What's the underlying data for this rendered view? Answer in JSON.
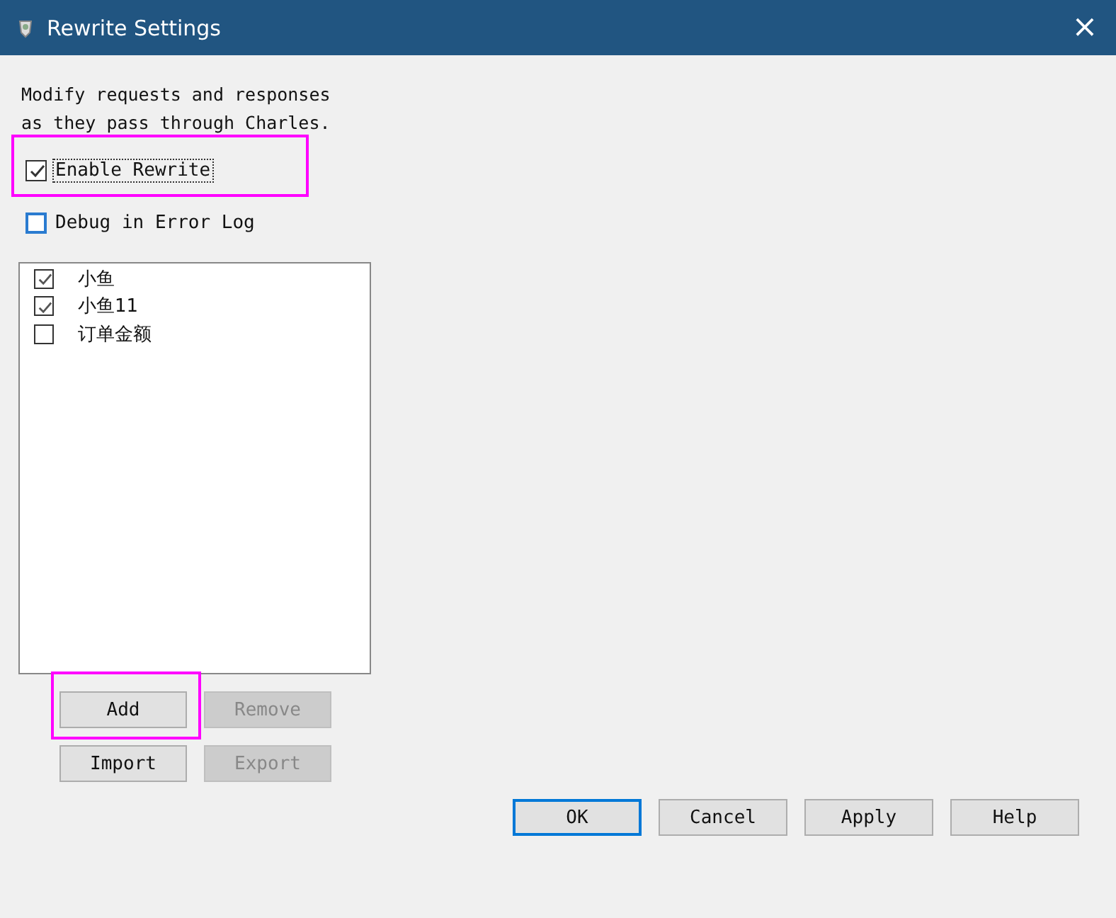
{
  "window": {
    "title": "Rewrite Settings",
    "close": "×"
  },
  "description": "Modify requests and responses\nas they pass through Charles.",
  "options": [
    {
      "label": "Enable Rewrite",
      "checked": true,
      "focused": true,
      "highlighted": true
    },
    {
      "label": "Debug in Error Log",
      "checked": false,
      "focused": false,
      "highlighted": false
    }
  ],
  "rules": [
    {
      "label": "小鱼",
      "checked": true
    },
    {
      "label": "小鱼11",
      "checked": true
    },
    {
      "label": "订单金额",
      "checked": false
    }
  ],
  "list_buttons": [
    {
      "label": "Add",
      "disabled": false,
      "highlighted": true
    },
    {
      "label": "Remove",
      "disabled": true,
      "highlighted": false
    },
    {
      "label": "Import",
      "disabled": false,
      "highlighted": false
    },
    {
      "label": "Export",
      "disabled": true,
      "highlighted": false
    }
  ],
  "dialog_buttons": [
    {
      "label": "OK",
      "default": true
    },
    {
      "label": "Cancel",
      "default": false
    },
    {
      "label": "Apply",
      "default": false
    },
    {
      "label": "Help",
      "default": false
    }
  ]
}
